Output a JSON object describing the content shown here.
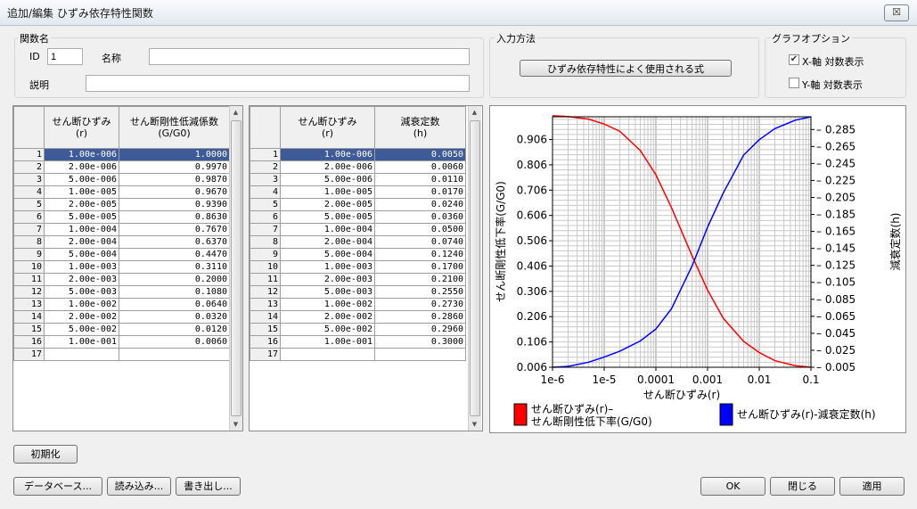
{
  "window": {
    "title": "追加/編集 ひずみ依存特性関数",
    "close_glyph": "☒"
  },
  "function_group": {
    "label": "関数名",
    "id_label": "ID",
    "id_value": "1",
    "name_label": "名称",
    "name_value": "",
    "desc_label": "説明",
    "desc_value": ""
  },
  "input_method": {
    "label": "入力方法",
    "button": "ひずみ依存特性によく使用される式"
  },
  "graph_options": {
    "label": "グラフオプション",
    "x_log_label": "X-軸 対数表示",
    "x_log_checked": true,
    "y_log_label": "Y-軸 対数表示",
    "y_log_checked": false
  },
  "table1": {
    "headers": [
      "せん断ひずみ\n(r)",
      "せん断剛性低減係数\n(G/G0)"
    ],
    "rows": [
      [
        "1",
        "1.00e-006",
        "1.0000"
      ],
      [
        "2",
        "2.00e-006",
        "0.9970"
      ],
      [
        "3",
        "5.00e-006",
        "0.9870"
      ],
      [
        "4",
        "1.00e-005",
        "0.9670"
      ],
      [
        "5",
        "2.00e-005",
        "0.9390"
      ],
      [
        "6",
        "5.00e-005",
        "0.8630"
      ],
      [
        "7",
        "1.00e-004",
        "0.7670"
      ],
      [
        "8",
        "2.00e-004",
        "0.6370"
      ],
      [
        "9",
        "5.00e-004",
        "0.4470"
      ],
      [
        "10",
        "1.00e-003",
        "0.3110"
      ],
      [
        "11",
        "2.00e-003",
        "0.2000"
      ],
      [
        "12",
        "5.00e-003",
        "0.1080"
      ],
      [
        "13",
        "1.00e-002",
        "0.0640"
      ],
      [
        "14",
        "2.00e-002",
        "0.0320"
      ],
      [
        "15",
        "5.00e-002",
        "0.0120"
      ],
      [
        "16",
        "1.00e-001",
        "0.0060"
      ],
      [
        "17",
        "",
        ""
      ]
    ]
  },
  "table2": {
    "headers": [
      "せん断ひずみ\n(r)",
      "減衰定数\n(h)"
    ],
    "rows": [
      [
        "1",
        "1.00e-006",
        "0.0050"
      ],
      [
        "2",
        "2.00e-006",
        "0.0060"
      ],
      [
        "3",
        "5.00e-006",
        "0.0110"
      ],
      [
        "4",
        "1.00e-005",
        "0.0170"
      ],
      [
        "5",
        "2.00e-005",
        "0.0240"
      ],
      [
        "6",
        "5.00e-005",
        "0.0360"
      ],
      [
        "7",
        "1.00e-004",
        "0.0500"
      ],
      [
        "8",
        "2.00e-004",
        "0.0740"
      ],
      [
        "9",
        "5.00e-004",
        "0.1240"
      ],
      [
        "10",
        "1.00e-003",
        "0.1700"
      ],
      [
        "11",
        "2.00e-003",
        "0.2100"
      ],
      [
        "12",
        "5.00e-003",
        "0.2550"
      ],
      [
        "13",
        "1.00e-002",
        "0.2730"
      ],
      [
        "14",
        "2.00e-002",
        "0.2860"
      ],
      [
        "15",
        "5.00e-002",
        "0.2960"
      ],
      [
        "16",
        "1.00e-001",
        "0.3000"
      ],
      [
        "17",
        "",
        ""
      ]
    ]
  },
  "chart_data": {
    "type": "line",
    "x_scale": "log",
    "xlim": [
      1e-06,
      0.1
    ],
    "ylim": [
      0.006,
      0.996
    ],
    "y2lim": [
      0.005,
      0.3
    ],
    "xlabel": "せん断ひずみ(r)",
    "ylabel": "せん断剛性低下率(G/G0)",
    "y2label": "減衰定数(h)",
    "x_ticks": [
      "1e-6",
      "1e-5",
      "0.0001",
      "0.001",
      "0.01",
      "0.1"
    ],
    "y_ticks": [
      "0.006",
      "0.106",
      "0.206",
      "0.306",
      "0.406",
      "0.506",
      "0.606",
      "0.706",
      "0.806",
      "0.906"
    ],
    "y2_ticks": [
      "0.005",
      "0.025",
      "0.045",
      "0.065",
      "0.085",
      "0.105",
      "0.125",
      "0.145",
      "0.165",
      "0.185",
      "0.205",
      "0.225",
      "0.245",
      "0.265",
      "0.285"
    ],
    "x": [
      1e-06,
      2e-06,
      5e-06,
      1e-05,
      2e-05,
      5e-05,
      0.0001,
      0.0002,
      0.0005,
      0.001,
      0.002,
      0.005,
      0.01,
      0.02,
      0.05,
      0.1
    ],
    "series": [
      {
        "name": "せん断ひずみ(r)–せん断剛性低下率(G/G0)",
        "axis": "left",
        "color": "#ff0000",
        "values": [
          1.0,
          0.997,
          0.987,
          0.967,
          0.939,
          0.863,
          0.767,
          0.637,
          0.447,
          0.311,
          0.2,
          0.108,
          0.064,
          0.032,
          0.012,
          0.006
        ]
      },
      {
        "name": "せん断ひずみ(r)-減衰定数(h)",
        "axis": "right",
        "color": "#0000ff",
        "values": [
          0.005,
          0.006,
          0.011,
          0.017,
          0.024,
          0.036,
          0.05,
          0.074,
          0.124,
          0.17,
          0.21,
          0.255,
          0.273,
          0.286,
          0.296,
          0.3
        ]
      }
    ],
    "legend": [
      {
        "line1": "せん断ひずみ(r)–",
        "line2": "せん断剛性低下率(G/G0)",
        "color": "#ff0000"
      },
      {
        "line1": "せん断ひずみ(r)-減衰定数(h)",
        "color": "#0000ff"
      }
    ],
    "grid": true
  },
  "buttons": {
    "init": "初期化",
    "database": "データベース...",
    "load": "読み込み...",
    "export": "書き出し...",
    "ok": "OK",
    "close": "閉じる",
    "apply": "適用"
  }
}
